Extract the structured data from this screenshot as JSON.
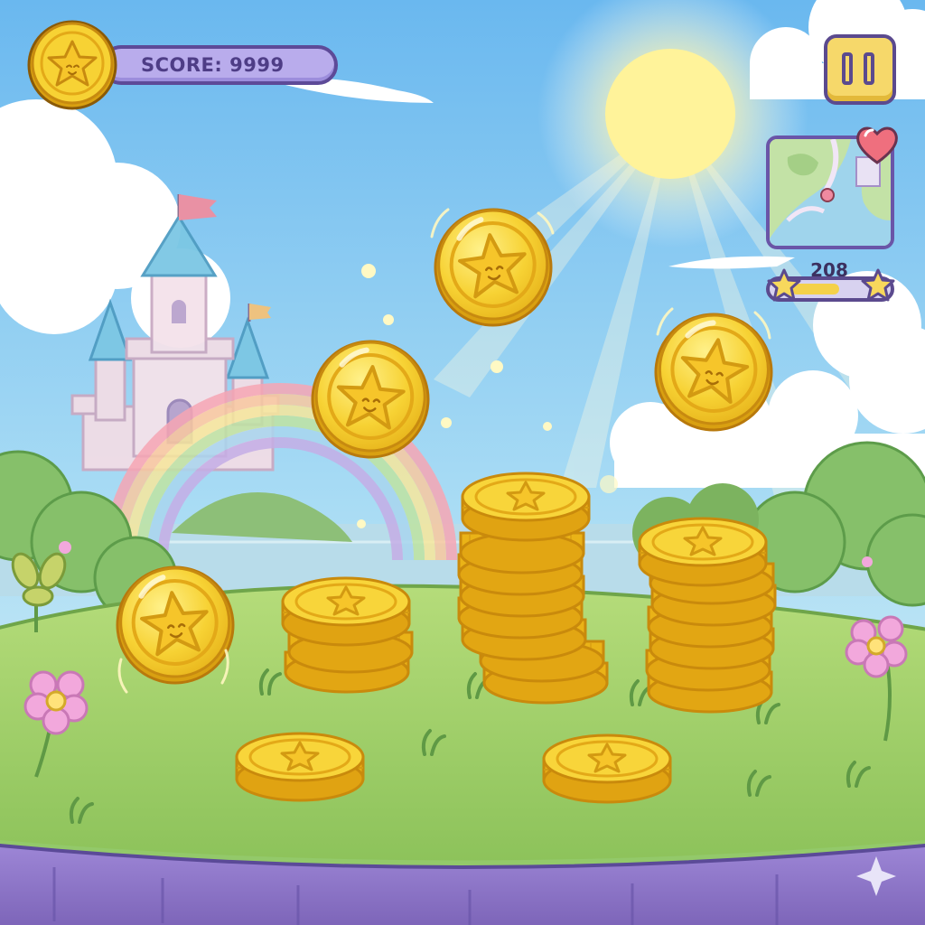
{
  "hud": {
    "score_label": "SCORE: 9999",
    "progress_count": "208",
    "progress_fraction": 0.62
  },
  "icons": {
    "score": "star-coin-icon",
    "pause": "pause-icon",
    "map": "minimap-icon",
    "heart": "heart-icon",
    "progress_star": "star-icon"
  },
  "colors": {
    "sky_top": "#6ab8ef",
    "sky_bottom": "#d8f0fa",
    "grass": "#a8d26a",
    "coin": "#f7d234",
    "coin_edge": "#d9a011",
    "hud_purple": "#5b4a98",
    "cliff": "#8f77c9"
  }
}
